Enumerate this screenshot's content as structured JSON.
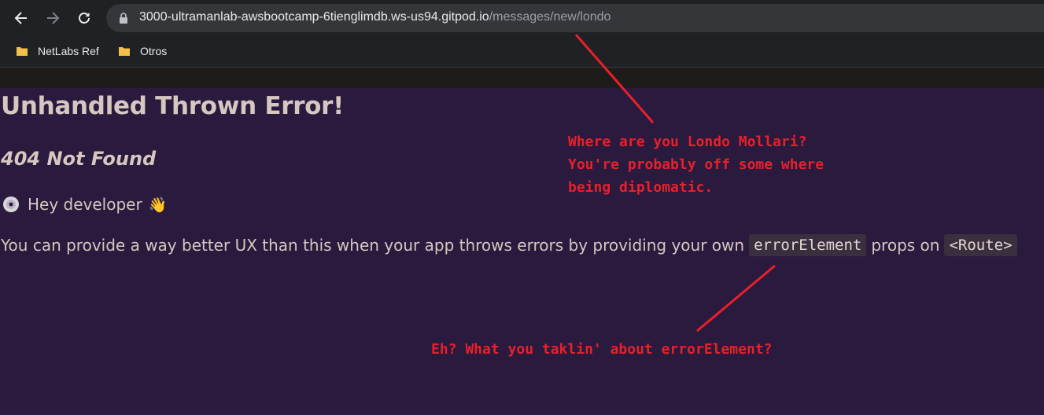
{
  "browser": {
    "url_host": "3000-ultramanlab-awsbootcamp-6tienglimdb.ws-us94.gitpod.io",
    "url_path": "/messages/new/londo",
    "bookmarks": [
      {
        "label": "NetLabs Ref",
        "icon": "folder-icon"
      },
      {
        "label": "Otros",
        "icon": "folder-icon"
      }
    ]
  },
  "page": {
    "title": "Unhandled Thrown Error!",
    "status": "404 Not Found",
    "dev_greeting": "Hey developer",
    "wave_emoji": "👋",
    "desc_before": "You can provide a way better UX than this when your app throws errors by providing your own",
    "code_prop": "errorElement",
    "desc_middle": "props on",
    "code_route": "<Route>"
  },
  "annotations": {
    "note_top": [
      "Where are you Londo Mollari?",
      "You're probably off some where",
      "being diplomatic."
    ],
    "note_bottom": "Eh? What you taklin' about errorElement?",
    "color": "#e8202a"
  },
  "colors": {
    "page_bg": "#2a1a3e",
    "text": "#d6c7c0",
    "chrome_bg": "#202124"
  }
}
